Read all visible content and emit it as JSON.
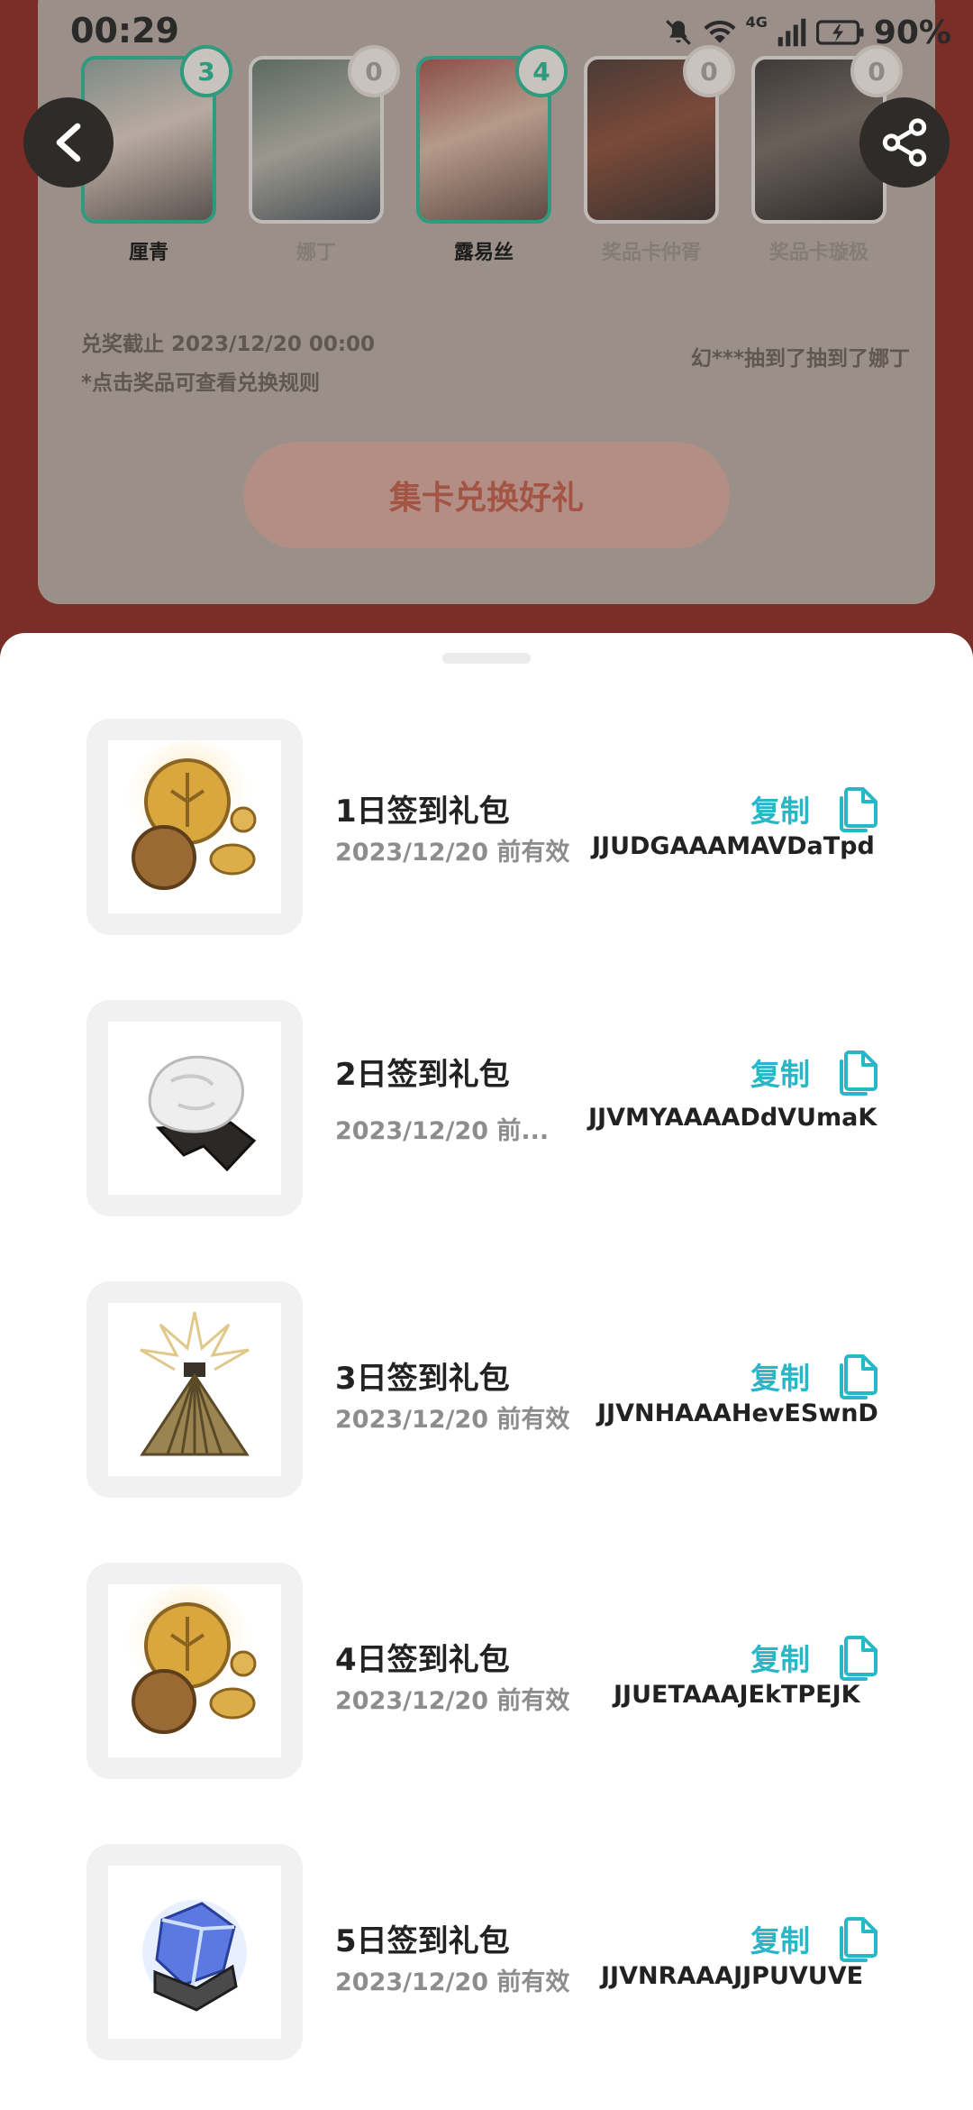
{
  "status_bar": {
    "time": "00:29",
    "network": "4G",
    "battery": "90%"
  },
  "cards": [
    {
      "name": "厘青",
      "count": "3",
      "owned": true
    },
    {
      "name": "娜丁",
      "count": "0",
      "owned": false
    },
    {
      "name": "露易丝",
      "count": "4",
      "owned": true
    },
    {
      "name": "奖品卡仲胥",
      "count": "0",
      "owned": false
    },
    {
      "name": "奖品卡璇极",
      "count": "0",
      "owned": false
    }
  ],
  "nav": {
    "back_icon": "chevron-left-icon",
    "share_icon": "share-icon"
  },
  "info": {
    "deadline": "兑奖截止 2023/12/20 00:00",
    "hint": "*点击奖品可查看兑换规则",
    "ticker": "幻***抽到了抽到了娜丁"
  },
  "exchange_button": "集卡兑换好礼",
  "gifts": [
    {
      "title": "1日签到礼包",
      "expiry": "2023/12/20 前有效",
      "code": "JJUDGAAAMAVDaTpd",
      "copy_label": "复制",
      "icon": "gold-coins"
    },
    {
      "title": "2日签到礼包",
      "expiry": "2023/12/20 前...",
      "code": "JJVMYAAAADdVUmaK",
      "copy_label": "复制",
      "icon": "silver-ore"
    },
    {
      "title": "3日签到礼包",
      "expiry": "2023/12/20 前有效",
      "code": "JJVNHAAAHevESwnD",
      "copy_label": "复制",
      "icon": "golden-lantern"
    },
    {
      "title": "4日签到礼包",
      "expiry": "2023/12/20 前有效",
      "code": "JJUETAAAJEkTPEJK",
      "copy_label": "复制",
      "icon": "gold-coins"
    },
    {
      "title": "5日签到礼包",
      "expiry": "2023/12/20 前有效",
      "code": "JJVNRAAAJJPUVUVE",
      "copy_label": "复制",
      "icon": "blue-crystal"
    }
  ]
}
